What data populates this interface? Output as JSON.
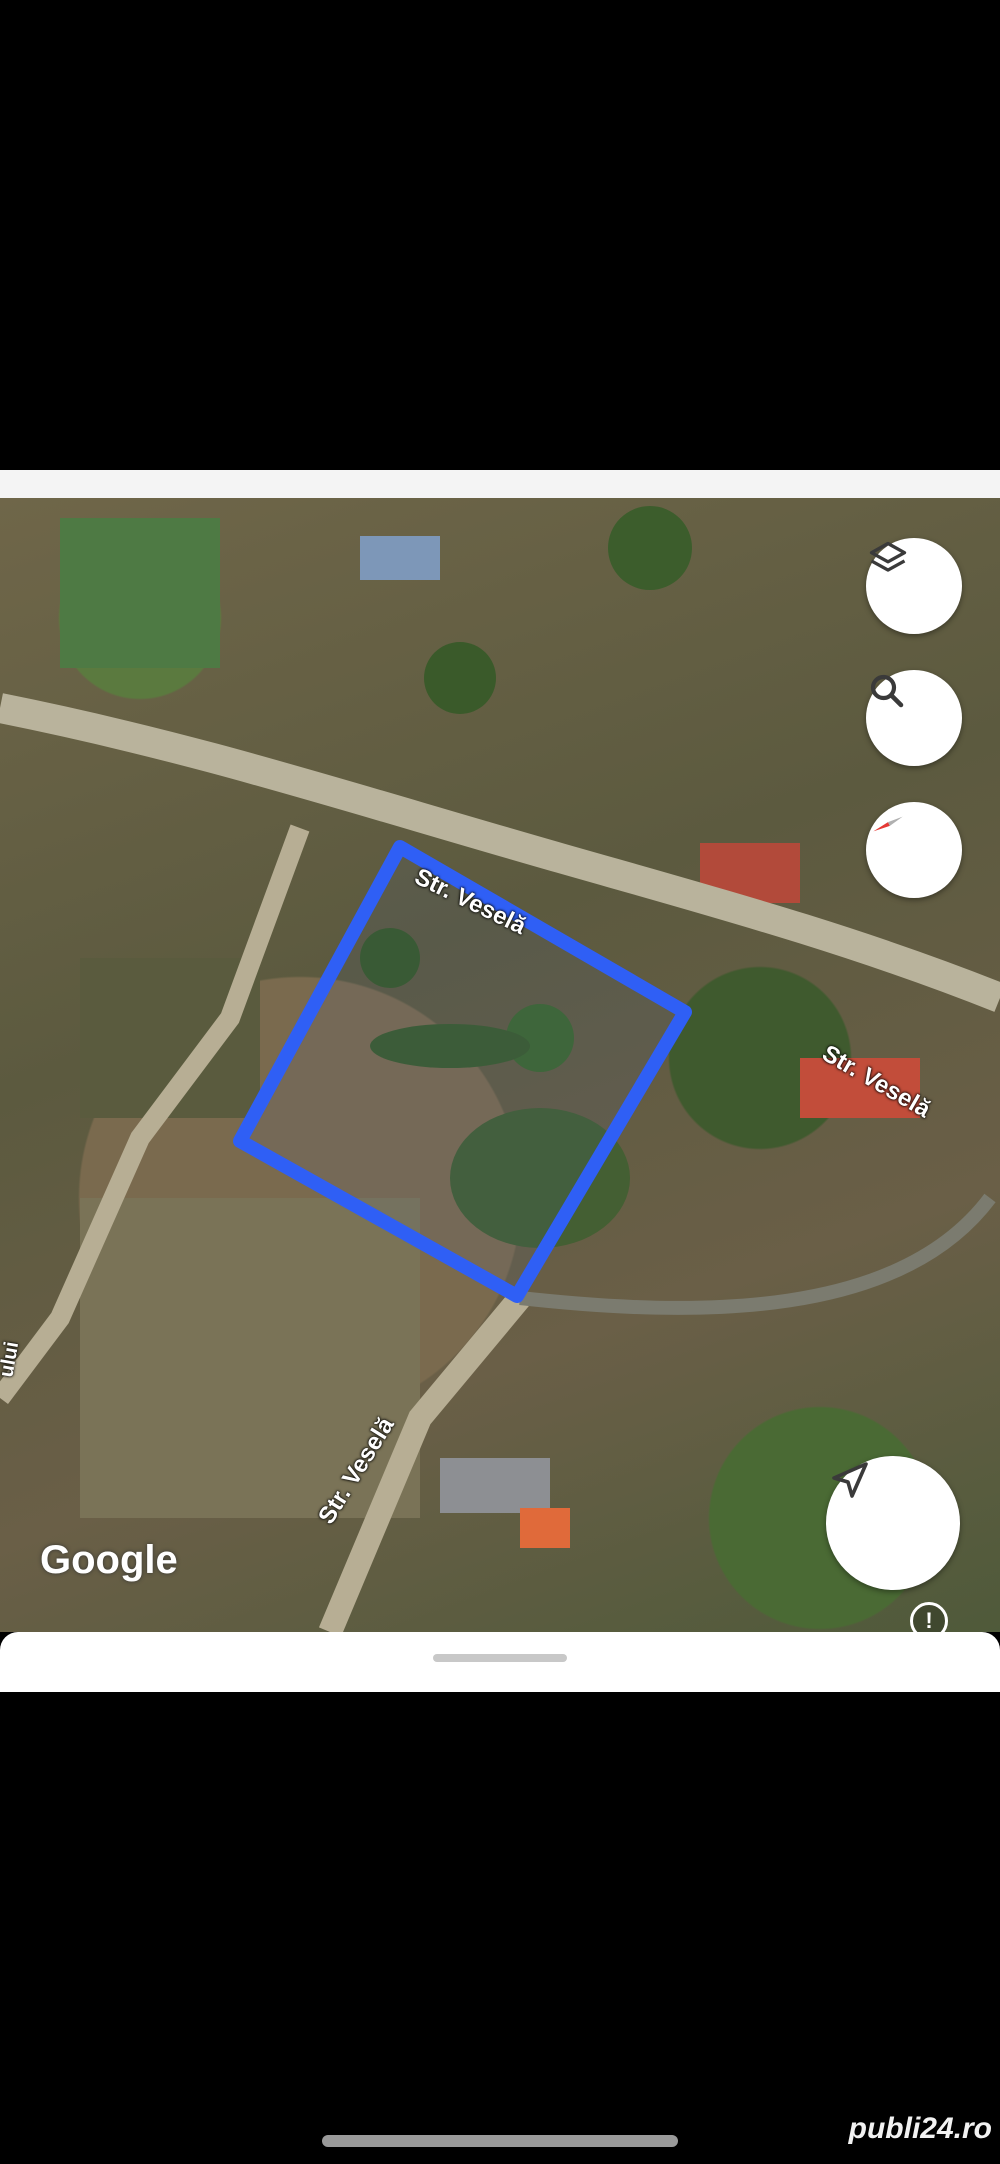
{
  "map": {
    "street_labels": [
      "Str. Veselă",
      "Str. Veselă",
      "Str. Veselă"
    ],
    "partial_street_label": "ului",
    "google_logo": "Google",
    "colors": {
      "boundary": "#2f5ff5",
      "compass_needle": "#e53935"
    }
  },
  "controls": {
    "layers_icon": "layers-icon",
    "search_icon": "search-icon",
    "compass_icon": "compass-icon",
    "navigate_icon": "navigation-arrow-icon",
    "info_label": "!"
  },
  "watermark": "publi24.ro"
}
